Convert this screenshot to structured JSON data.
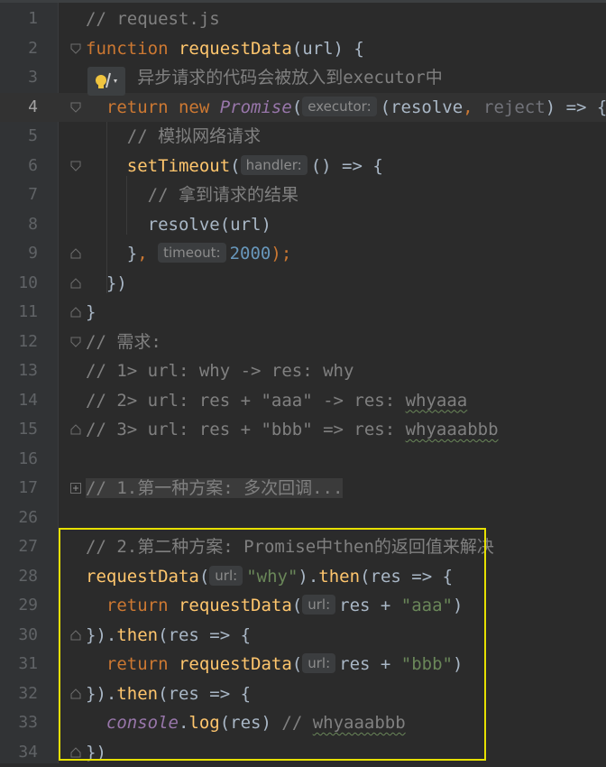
{
  "colors": {
    "background": "#2b2b2b",
    "gutter": "#313335",
    "keyword": "#cc7832",
    "function": "#ffc66d",
    "string": "#6a8759",
    "number": "#6897bb",
    "comment": "#808080",
    "highlight_box": "#e6e000"
  },
  "current_line": "4",
  "lines": [
    {
      "n": "1",
      "tokens": [
        {
          "t": "// request.js",
          "c": "cmt"
        }
      ]
    },
    {
      "n": "2",
      "tokens": [
        {
          "t": "function ",
          "c": "kw"
        },
        {
          "t": "requestData",
          "c": "fn"
        },
        {
          "t": "(url) {",
          "c": ""
        }
      ]
    },
    {
      "n": "3",
      "tokens": [
        {
          "t": "     异步请求的代码会被放入到executor中",
          "c": "cmt"
        }
      ]
    },
    {
      "n": "4",
      "tokens": [
        {
          "t": "  return new ",
          "c": "kw"
        },
        {
          "t": "Promise",
          "c": "cls"
        },
        {
          "t": "(",
          "c": ""
        },
        {
          "t": "executor:",
          "c": "hint"
        },
        {
          "t": "(resolve",
          "c": ""
        },
        {
          "t": ", ",
          "c": "kw"
        },
        {
          "t": "reject",
          "c": "unused"
        },
        {
          "t": ") => {",
          "c": ""
        }
      ]
    },
    {
      "n": "5",
      "tokens": [
        {
          "t": "    // 模拟网络请求",
          "c": "cmt"
        }
      ]
    },
    {
      "n": "6",
      "tokens": [
        {
          "t": "    setTimeout",
          "c": "fn"
        },
        {
          "t": "(",
          "c": ""
        },
        {
          "t": "handler:",
          "c": "hint"
        },
        {
          "t": "() => {",
          "c": ""
        }
      ]
    },
    {
      "n": "7",
      "tokens": [
        {
          "t": "      // 拿到请求的结果",
          "c": "cmt"
        }
      ]
    },
    {
      "n": "8",
      "tokens": [
        {
          "t": "      resolve(url)",
          "c": ""
        }
      ]
    },
    {
      "n": "9",
      "tokens": [
        {
          "t": "    }",
          "c": ""
        },
        {
          "t": ", ",
          "c": "kw"
        },
        {
          "t": "timeout:",
          "c": "hint"
        },
        {
          "t": "2000",
          "c": "num"
        },
        {
          "t": ");",
          "c": "kw"
        }
      ]
    },
    {
      "n": "10",
      "tokens": [
        {
          "t": "  })",
          "c": ""
        }
      ]
    },
    {
      "n": "11",
      "tokens": [
        {
          "t": "}",
          "c": ""
        }
      ]
    },
    {
      "n": "12",
      "tokens": [
        {
          "t": "// 需求:",
          "c": "cmt"
        }
      ]
    },
    {
      "n": "13",
      "tokens": [
        {
          "t": "// 1> url: why -> res: why",
          "c": "cmt"
        }
      ]
    },
    {
      "n": "14",
      "tokens": [
        {
          "t": "// 2> url: res + \"aaa\" -> res: ",
          "c": "cmt"
        },
        {
          "t": "whyaaa",
          "c": "cmt squig"
        }
      ]
    },
    {
      "n": "15",
      "tokens": [
        {
          "t": "// 3> url: res + \"bbb\" => res: ",
          "c": "cmt"
        },
        {
          "t": "whyaaabbb",
          "c": "cmt squig"
        }
      ]
    },
    {
      "n": "16",
      "tokens": []
    },
    {
      "n": "17",
      "tokens": [
        {
          "t": "// 1.第一种方案: 多次回调...",
          "c": "cmt folded"
        }
      ]
    },
    {
      "n": "26",
      "tokens": []
    },
    {
      "n": "27",
      "tokens": [
        {
          "t": "// 2.第二种方案: Promise中then的返回值来解决",
          "c": "cmt"
        }
      ]
    },
    {
      "n": "28",
      "tokens": [
        {
          "t": "requestData",
          "c": "fn"
        },
        {
          "t": "(",
          "c": ""
        },
        {
          "t": "url:",
          "c": "hint"
        },
        {
          "t": "\"why\"",
          "c": "str"
        },
        {
          "t": ").",
          "c": ""
        },
        {
          "t": "then",
          "c": "fn"
        },
        {
          "t": "(res => {",
          "c": ""
        }
      ]
    },
    {
      "n": "29",
      "tokens": [
        {
          "t": "  return ",
          "c": "kw"
        },
        {
          "t": "requestData",
          "c": "fn"
        },
        {
          "t": "(",
          "c": ""
        },
        {
          "t": "url:",
          "c": "hint"
        },
        {
          "t": "res + ",
          "c": ""
        },
        {
          "t": "\"aaa\"",
          "c": "str"
        },
        {
          "t": ")",
          "c": ""
        }
      ]
    },
    {
      "n": "30",
      "tokens": [
        {
          "t": "}).",
          "c": ""
        },
        {
          "t": "then",
          "c": "fn"
        },
        {
          "t": "(res => {",
          "c": ""
        }
      ]
    },
    {
      "n": "31",
      "tokens": [
        {
          "t": "  return ",
          "c": "kw"
        },
        {
          "t": "requestData",
          "c": "fn"
        },
        {
          "t": "(",
          "c": ""
        },
        {
          "t": "url:",
          "c": "hint"
        },
        {
          "t": "res + ",
          "c": ""
        },
        {
          "t": "\"bbb\"",
          "c": "str"
        },
        {
          "t": ")",
          "c": ""
        }
      ]
    },
    {
      "n": "32",
      "tokens": [
        {
          "t": "}).",
          "c": ""
        },
        {
          "t": "then",
          "c": "fn"
        },
        {
          "t": "(res => {",
          "c": ""
        }
      ]
    },
    {
      "n": "33",
      "tokens": [
        {
          "t": "  console",
          "c": "cls"
        },
        {
          "t": ".",
          "c": ""
        },
        {
          "t": "log",
          "c": "fn"
        },
        {
          "t": "(res) ",
          "c": ""
        },
        {
          "t": "// ",
          "c": "cmt"
        },
        {
          "t": "whyaaabbb",
          "c": "cmt squig"
        }
      ]
    },
    {
      "n": "34",
      "tokens": [
        {
          "t": "})",
          "c": ""
        }
      ]
    }
  ],
  "fold_markers": {
    "2": "open",
    "4": "open",
    "6": "open",
    "9": "close",
    "10": "close",
    "11": "close",
    "12": "open",
    "15": "close",
    "17": "folded",
    "30": "close",
    "32": "close",
    "34": "close"
  }
}
